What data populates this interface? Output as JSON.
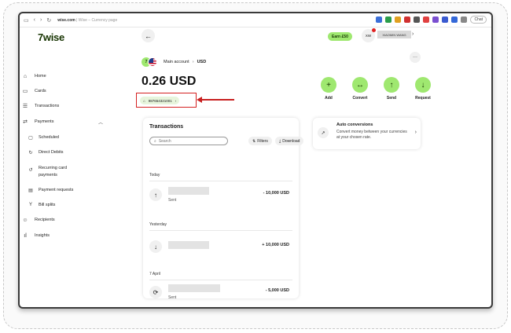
{
  "browser": {
    "url_host": "wise.com",
    "url_path": " | Wise – Currency page",
    "chat_label": "Chat"
  },
  "logo": "7wise",
  "sidebar": {
    "items": [
      {
        "label": "Home",
        "icon": "home-icon"
      },
      {
        "label": "Cards",
        "icon": "card-icon"
      },
      {
        "label": "Transactions",
        "icon": "list-icon"
      },
      {
        "label": "Payments",
        "icon": "payments-icon"
      },
      {
        "label": "Scheduled",
        "icon": "calendar-icon"
      },
      {
        "label": "Direct Debits",
        "icon": "refresh-icon"
      },
      {
        "label": "Recurring card",
        "label2": "payments",
        "icon": "recurring-icon"
      },
      {
        "label": "Payment requests",
        "icon": "request-icon"
      },
      {
        "label": "Bill splits",
        "icon": "split-icon"
      },
      {
        "label": "Recipients",
        "icon": "people-icon"
      },
      {
        "label": "Insights",
        "icon": "chart-icon"
      }
    ]
  },
  "header": {
    "earn_label": "Earn £50",
    "avatar_initials": "XW",
    "user_name": "XIAOMIN WANG"
  },
  "breadcrumb": {
    "parent": "Main account",
    "current": "USD"
  },
  "balance": "0.26 USD",
  "account_number": "987654321001",
  "actions": [
    {
      "label": "Add",
      "glyph": "+"
    },
    {
      "label": "Convert",
      "glyph": "↔"
    },
    {
      "label": "Send",
      "glyph": "↑"
    },
    {
      "label": "Request",
      "glyph": "↓"
    }
  ],
  "transactions": {
    "title": "Transactions",
    "search_placeholder": "Search",
    "filters_label": "Filters",
    "download_label": "Download",
    "groups": [
      {
        "date": "Today",
        "status": "Sent",
        "amount": "- 10,000 USD"
      },
      {
        "date": "Yesterday",
        "status": "",
        "amount": "+ 10,000 USD"
      },
      {
        "date": "7 April",
        "status": "Sent",
        "amount": "- 5,000 USD"
      }
    ]
  },
  "auto_conversions": {
    "title": "Auto conversions",
    "description": "Convert money between your currencies at your chosen rate."
  },
  "colors": {
    "accent": "#9fe870",
    "brand_dark": "#163300",
    "highlight_red": "#d42020"
  }
}
